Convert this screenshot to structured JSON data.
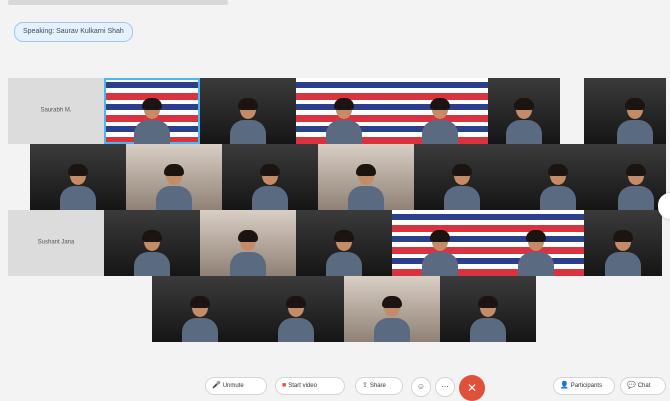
{
  "speaking_label": "Speaking: Saurav Kulkarni Shah",
  "grid": {
    "rows": [
      [
        {
          "type": "empty",
          "name": "Saurabh M.",
          "person": false
        },
        {
          "type": "flag",
          "active": true,
          "person": true
        },
        {
          "type": "room",
          "person": true
        },
        {
          "type": "flag",
          "person": true
        },
        {
          "type": "flag",
          "person": true
        },
        {
          "type": "room",
          "person": true
        },
        {
          "type": "room",
          "person": false
        },
        {
          "type": "room",
          "person": true
        }
      ],
      [
        {
          "type": "room",
          "person": true
        },
        {
          "type": "light",
          "person": true
        },
        {
          "type": "room",
          "person": true
        },
        {
          "type": "light",
          "person": true
        },
        {
          "type": "room",
          "person": true
        },
        {
          "type": "room",
          "person": true
        },
        {
          "type": "room",
          "person": true
        }
      ],
      [
        {
          "type": "empty",
          "name": "Sushant Jana",
          "person": false
        },
        {
          "type": "room",
          "person": true
        },
        {
          "type": "light",
          "person": true
        },
        {
          "type": "room",
          "person": true
        },
        {
          "type": "flag",
          "person": true
        },
        {
          "type": "flag",
          "person": true
        },
        {
          "type": "room",
          "person": true
        }
      ],
      [
        {
          "type": "room",
          "person": true
        },
        {
          "type": "room",
          "person": true
        },
        {
          "type": "light",
          "person": true
        },
        {
          "type": "room",
          "person": true
        }
      ]
    ]
  },
  "controls": {
    "unmute": "Unmute",
    "start_video": "Start video",
    "share": "Share",
    "participants": "Participants",
    "chat": "Chat"
  }
}
